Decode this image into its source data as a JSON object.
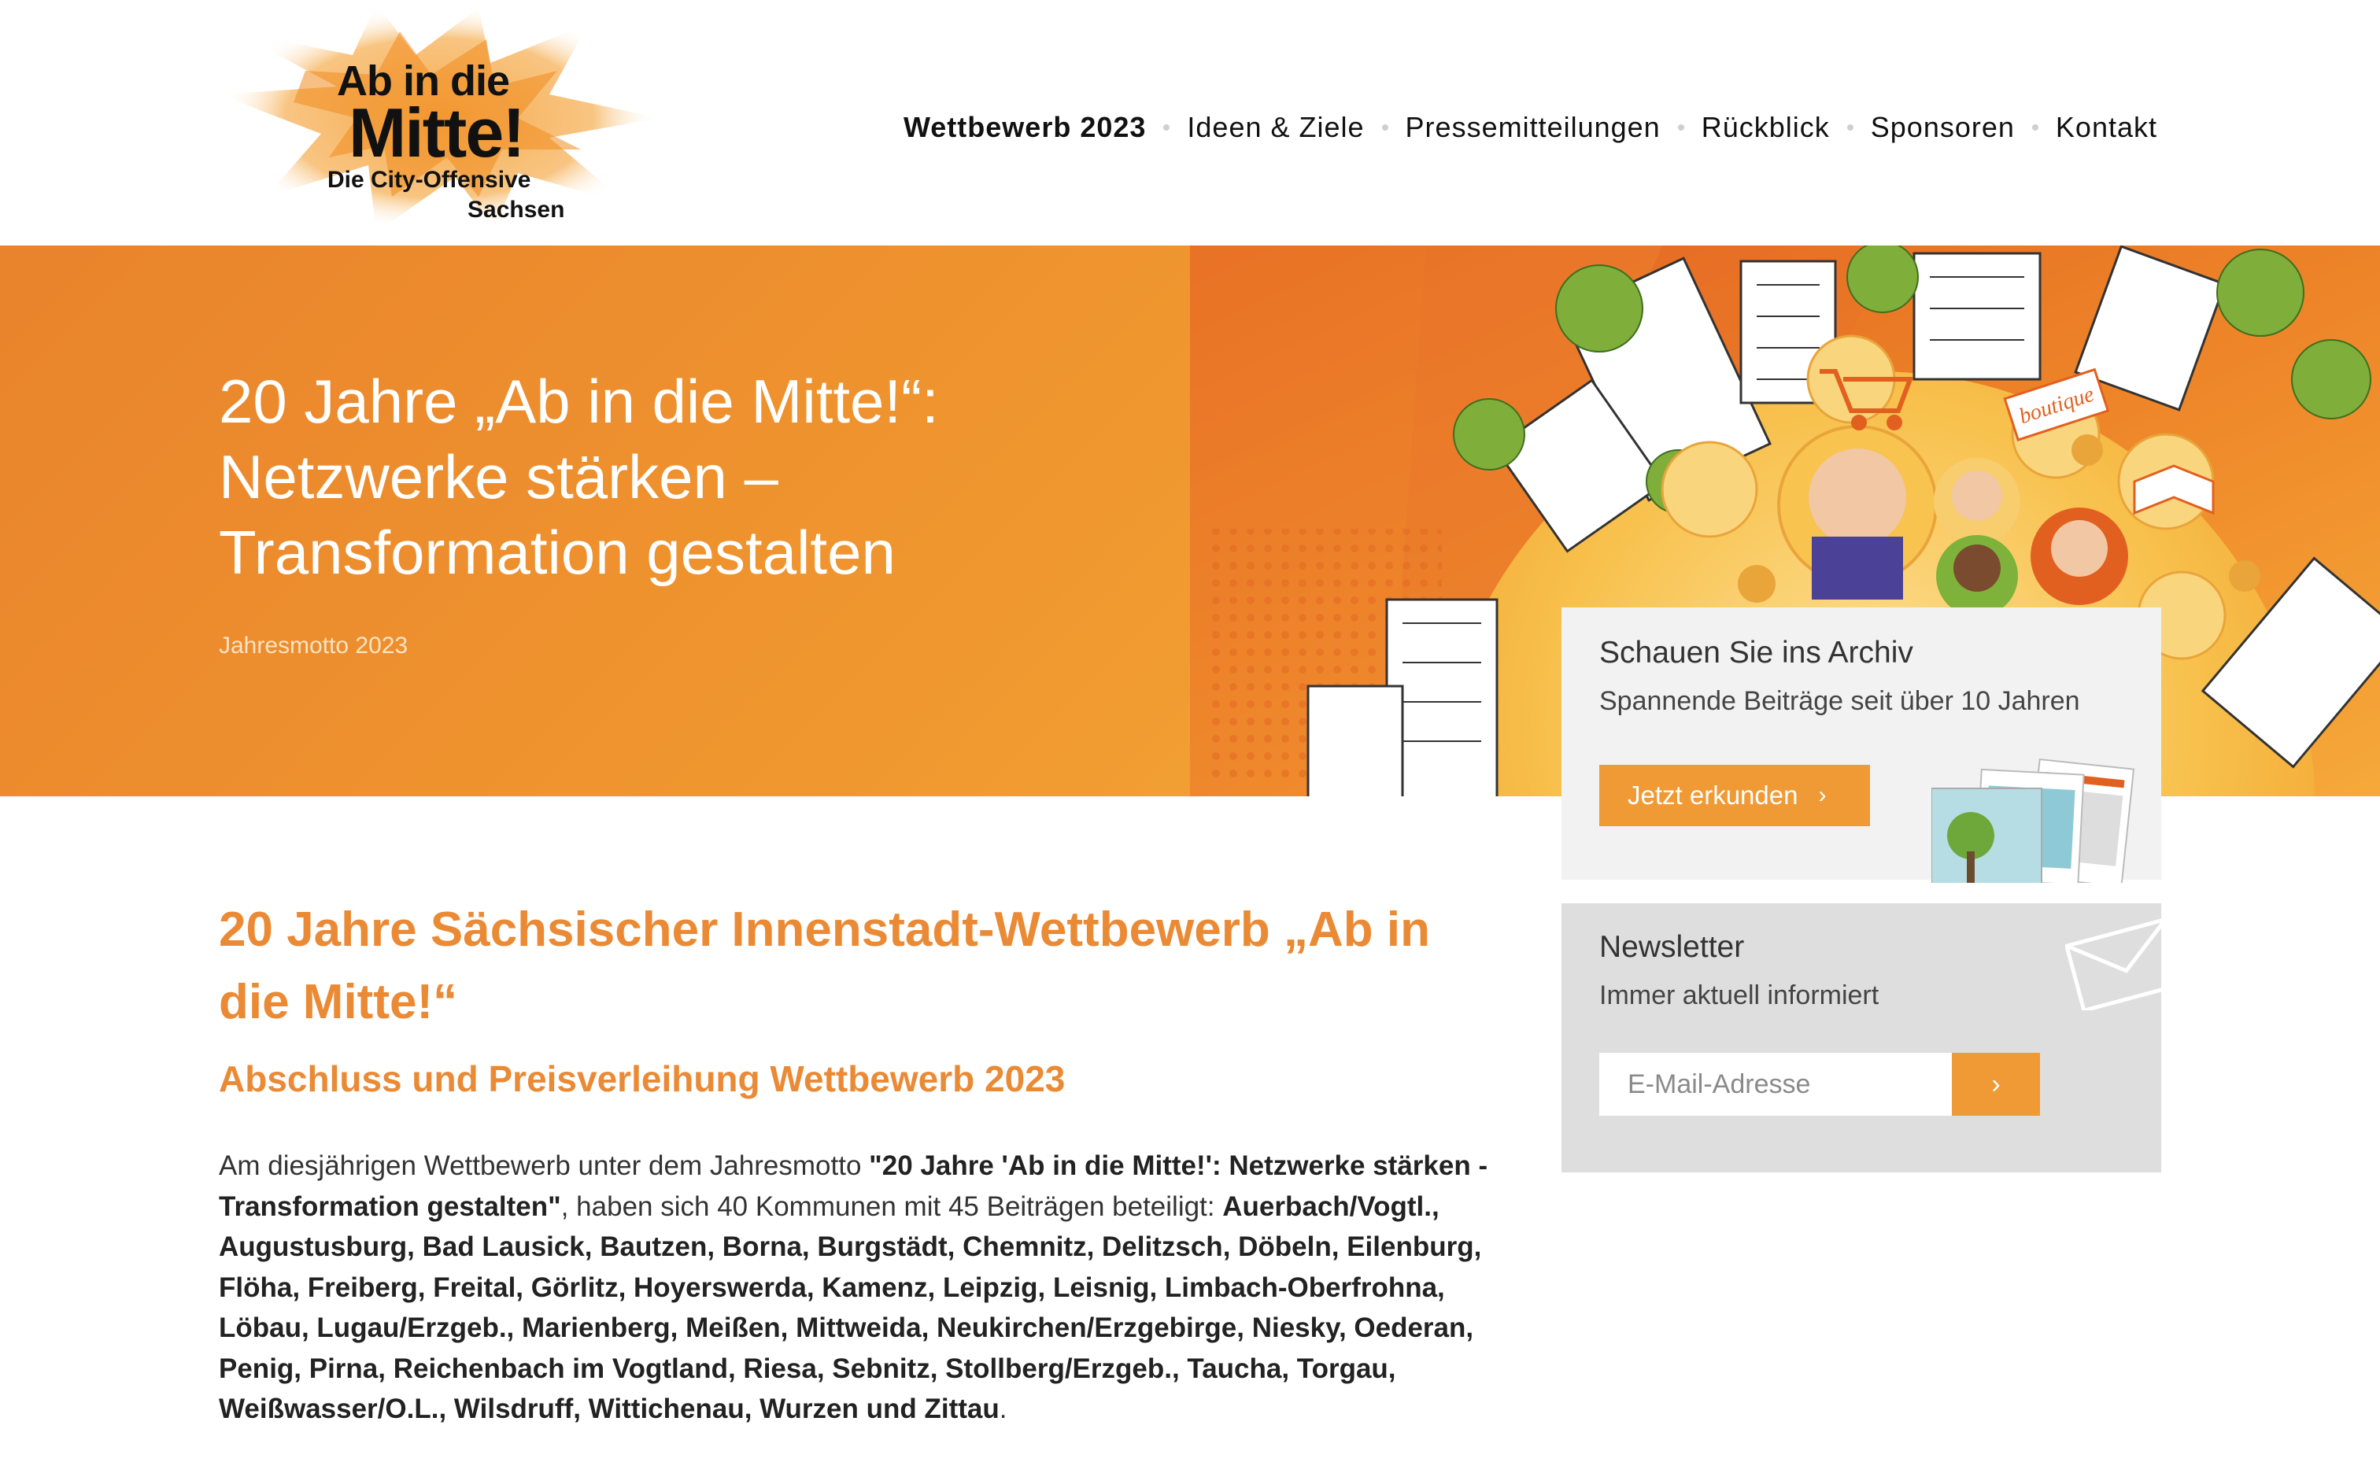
{
  "logo": {
    "line1": "Ab in die",
    "line2": "Mitte!",
    "line3": "Die City-Offensive",
    "line4": "Sachsen"
  },
  "nav": {
    "items": [
      {
        "label": "Wettbewerb 2023",
        "active": true
      },
      {
        "label": "Ideen & Ziele"
      },
      {
        "label": "Pressemitteilungen"
      },
      {
        "label": "Rückblick"
      },
      {
        "label": "Sponsoren"
      },
      {
        "label": "Kontakt"
      }
    ]
  },
  "hero": {
    "title": "20 Jahre „Ab in die Mitte!“: Netzwerke stärken – Transformation gestalten",
    "subtitle": "Jahresmotto 2023",
    "illustration_labels": {
      "boutique": "boutique"
    }
  },
  "archive_card": {
    "title": "Schauen Sie ins Archiv",
    "subtitle": "Spannende Beiträge seit über 10 Jahren",
    "button_label": "Jetzt erkunden",
    "button_icon": "chevron-right-icon"
  },
  "newsletter_card": {
    "title": "Newsletter",
    "subtitle": "Immer aktuell informiert",
    "email_placeholder": "E-Mail-Adresse",
    "submit_icon": "chevron-right-icon"
  },
  "main": {
    "heading": "20 Jahre Sächsischer Innenstadt-Wettbewerb „Ab in die Mitte!“",
    "subheading": "Abschluss und Preisverleihung Wettbewerb 2023",
    "intro_1": "Am diesjährigen Wettbewerb unter dem Jahresmotto ",
    "motto": "\"20 Jahre 'Ab in die Mitte!': Netzwerke stärken - Transformation gestalten\"",
    "intro_2": ", haben sich 40 Kommunen mit 45 Beiträgen beteiligt: ",
    "towns": "Auerbach/Vogtl., Augustusburg, Bad Lausick, Bautzen, Borna, Burgstädt, Chemnitz, Delitzsch, Döbeln, Eilenburg, Flöha, Freiberg, Freital, Görlitz, Hoyerswerda, Kamenz, Leipzig, Leisnig, Limbach-Oberfrohna, Löbau, Lugau/Erzgeb., Marienberg, Meißen, Mittweida, Neukirchen/Erzgebirge, Niesky, Oederan, Penig, Pirna, Reichenbach im Vogtland, Riesa, Sebnitz, Stollberg/Erzgeb., Taucha, Torgau, Weißwasser/O.L., Wilsdruff, Wittichenau, Wurzen und Zittau",
    "end": "."
  },
  "colors": {
    "accent": "#ea8a35",
    "button": "#ef9a35",
    "hero_from": "#e9832c",
    "hero_to": "#f5b33b"
  }
}
